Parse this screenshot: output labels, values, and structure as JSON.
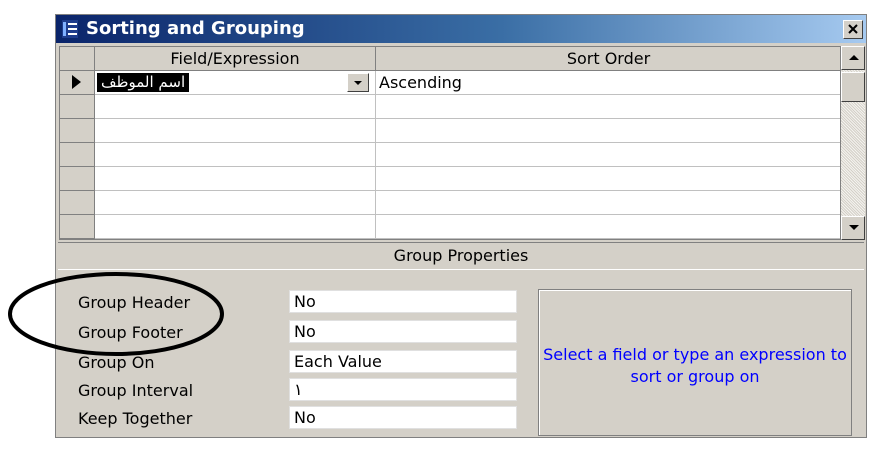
{
  "window": {
    "title": "Sorting and Grouping",
    "icon": "sorting-grouping-icon",
    "close_icon": "close-icon"
  },
  "grid": {
    "columns": [
      "Field/Expression",
      "Sort Order"
    ],
    "rows": [
      {
        "field": "اسم الموظف",
        "sort_order": "Ascending",
        "current": true
      },
      {
        "field": "",
        "sort_order": "",
        "current": false
      },
      {
        "field": "",
        "sort_order": "",
        "current": false
      },
      {
        "field": "",
        "sort_order": "",
        "current": false
      },
      {
        "field": "",
        "sort_order": "",
        "current": false
      },
      {
        "field": "",
        "sort_order": "",
        "current": false
      }
    ]
  },
  "group_properties": {
    "heading": "Group Properties",
    "items": [
      {
        "label": "Group Header",
        "value": "No"
      },
      {
        "label": "Group Footer",
        "value": "No"
      },
      {
        "label": "Group On",
        "value": "Each Value"
      },
      {
        "label": "Group Interval",
        "value": "١"
      },
      {
        "label": "Keep Together",
        "value": "No"
      }
    ],
    "help_text": "Select a field or type an expression to sort or group on"
  },
  "colors": {
    "title_start": "#0a246a",
    "title_end": "#a6caf0",
    "face": "#d4d0c8",
    "help_text": "#0000ff"
  }
}
